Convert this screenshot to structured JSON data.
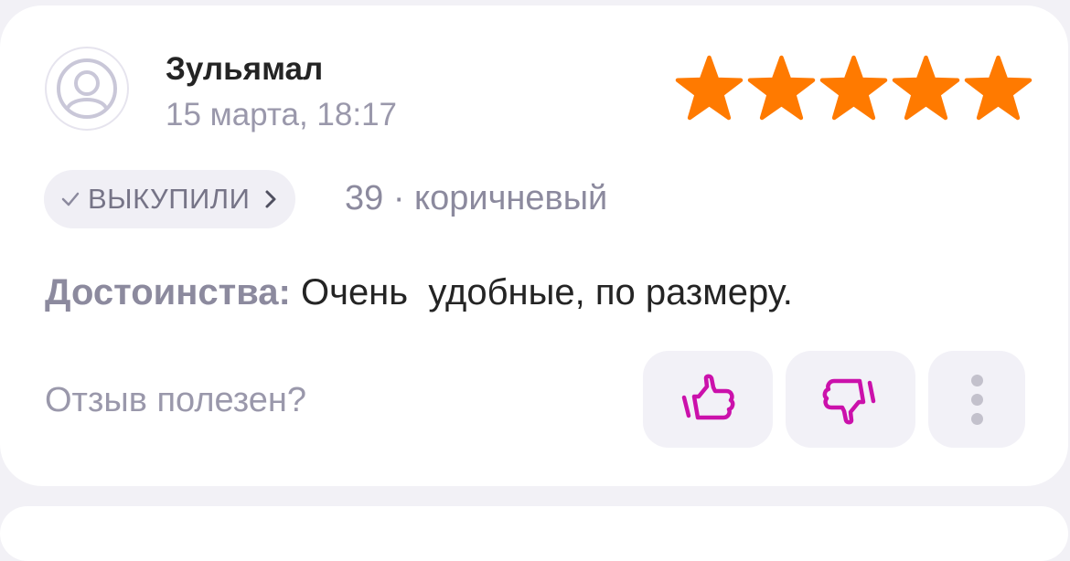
{
  "review": {
    "author": "Зульямал",
    "date": "15 марта, 18:17",
    "rating": 5,
    "rating_max": 5,
    "star_color": "#ff7a00",
    "status_badge": "ВЫКУПИЛИ",
    "variant": "39 · коричневый",
    "pros_label": "Достоинства:",
    "pros_text": "Очень  удобные, по размеру.",
    "helpful_question": "Отзыв полезен?"
  },
  "icons": {
    "avatar": "user-placeholder-icon",
    "badge_check": "checkmark-icon",
    "badge_chevron": "chevron-right-icon",
    "like": "thumbs-up-icon",
    "dislike": "thumbs-down-icon",
    "more": "more-vertical-icon"
  },
  "colors": {
    "accent": "#cb11ab",
    "background": "#f2f1f6",
    "card": "#ffffff"
  }
}
